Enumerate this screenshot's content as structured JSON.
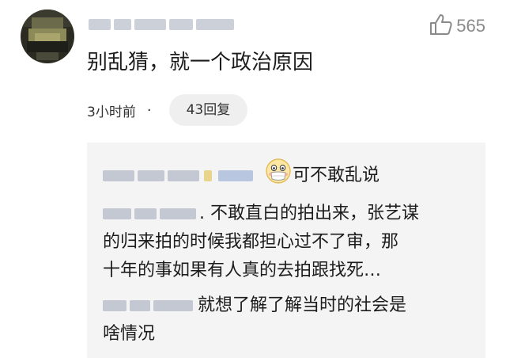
{
  "comment": {
    "text": "别乱猜，就一个政治原因",
    "time": "3小时前",
    "separator": "·",
    "reply_button_label": "43回复",
    "like_icon": "thumbs-up-icon",
    "like_count": "565"
  },
  "replies": [
    {
      "text": "可不敢乱说",
      "emoji": "masked-face-emoji"
    },
    {
      "line1": ". 不敢直白的拍出来，张艺谋",
      "line2": "的归来拍的时候我都担心过不了审，那",
      "line3": "十年的事如果有人真的去拍跟找死…"
    },
    {
      "line1": "就想了解了解当时的社会是",
      "line2": "啥情况"
    }
  ],
  "colors": {
    "background": "#ffffff",
    "reply_background": "#f4f4f4",
    "reply_button_background": "#efefef",
    "muted_text": "#8a8a8a",
    "text": "#1c1c1c"
  }
}
